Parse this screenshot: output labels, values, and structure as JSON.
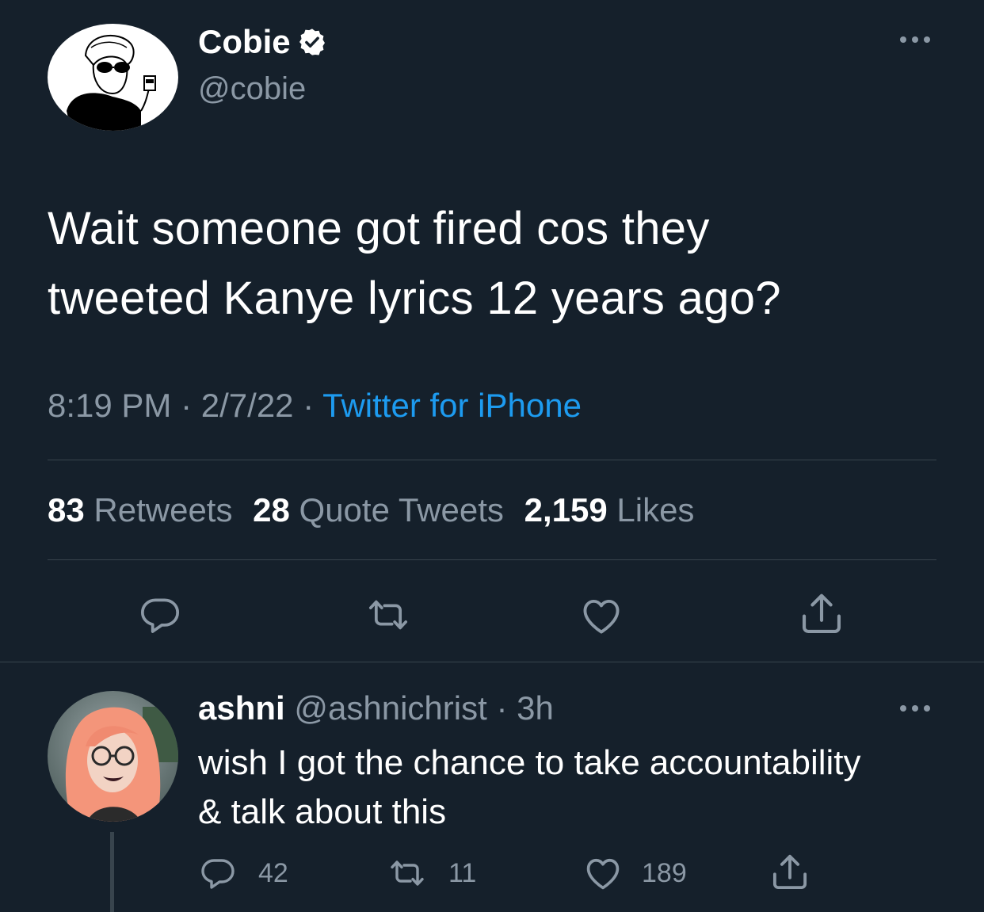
{
  "tweet": {
    "author": {
      "name": "Cobie",
      "handle": "@cobie",
      "verified": true,
      "avatar": "sketch-avatar"
    },
    "text_line1": "Wait someone got fired cos they",
    "text_line2": "tweeted Kanye lyrics 12 years ago?",
    "time": "8:19 PM",
    "sep1": "·",
    "date": "2/7/22",
    "sep2": "·",
    "source": "Twitter for iPhone",
    "stats": {
      "retweets_count": "83",
      "retweets_label": "Retweets",
      "quotes_count": "28",
      "quotes_label": "Quote Tweets",
      "likes_count": "2,159",
      "likes_label": "Likes"
    },
    "actions": [
      "reply-icon",
      "retweet-icon",
      "like-icon",
      "share-icon"
    ]
  },
  "reply": {
    "author": {
      "name": "ashni",
      "handle": "@ashnichrist",
      "sep": "·",
      "time": "3h",
      "avatar": "photo-avatar"
    },
    "text_line1": "wish I got the chance to take accountability",
    "text_line2": "& talk about this",
    "counts": {
      "replies": "42",
      "retweets": "11",
      "likes": "189"
    }
  },
  "colors": {
    "background": "#15202b",
    "text": "#ffffff",
    "muted": "#8b98a5",
    "accent": "#1d9bf0",
    "divider": "#38444d"
  }
}
